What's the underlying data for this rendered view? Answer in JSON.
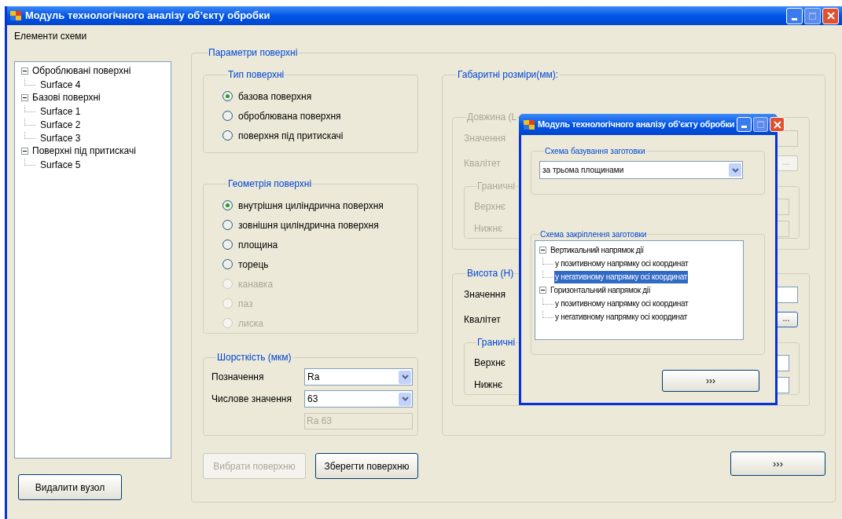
{
  "window": {
    "title": "Модуль технологічного аналізу об’єкту обробки"
  },
  "elements_panel": {
    "label": "Елементи схеми",
    "tree": [
      {
        "label": "Оброблювані поверхні",
        "expanded": true,
        "children": [
          {
            "label": "Surface 4"
          }
        ]
      },
      {
        "label": "Базові поверхні",
        "expanded": true,
        "children": [
          {
            "label": "Surface 1"
          },
          {
            "label": "Surface 2"
          },
          {
            "label": "Surface 3"
          }
        ]
      },
      {
        "label": "Поверхні під притискачі",
        "expanded": true,
        "children": [
          {
            "label": "Surface 5"
          }
        ]
      }
    ],
    "delete_button": "Видалити вузол"
  },
  "surface_params": {
    "title": "Параметри поверхні",
    "surface_type": {
      "title": "Тип поверхні",
      "options": [
        {
          "label": "базова поверхня",
          "selected": true,
          "disabled": false
        },
        {
          "label": "оброблювана поверхня",
          "selected": false,
          "disabled": false
        },
        {
          "label": "поверхня під притискачі",
          "selected": false,
          "disabled": false
        }
      ]
    },
    "geometry": {
      "title": "Геометрія поверхні",
      "options": [
        {
          "label": "внутрішня циліндрична поверхня",
          "selected": true,
          "disabled": false
        },
        {
          "label": "зовнішня циліндрична поверхня",
          "selected": false,
          "disabled": false
        },
        {
          "label": "площина",
          "selected": false,
          "disabled": false
        },
        {
          "label": "торець",
          "selected": false,
          "disabled": false
        },
        {
          "label": "канавка",
          "selected": false,
          "disabled": true
        },
        {
          "label": "паз",
          "selected": false,
          "disabled": true
        },
        {
          "label": "лиска",
          "selected": false,
          "disabled": true
        }
      ]
    },
    "roughness": {
      "title": "Шорсткість (мкм)",
      "designation_label": "Позначення",
      "designation_value": "Ra",
      "numeric_label": "Числове значення",
      "numeric_value": "63",
      "result": {
        "value": "Ra 63",
        "disabled": true
      }
    },
    "select_button": {
      "label": "Вибрати поверхню",
      "disabled": true
    },
    "save_button": {
      "label": "Зберегти поверхню",
      "disabled": false
    },
    "dimensions": {
      "title": "Габаритні розміри(мм):",
      "groups": [
        {
          "title": "Довжина (L",
          "disabled": true,
          "value_label": "Значення",
          "grade_label": "Квалітет",
          "grade_button": "...",
          "limits": {
            "title": "Граничні",
            "upper_label": "Верхнє",
            "lower_label": "Нижнє"
          }
        },
        {
          "title": "Висота (H)",
          "disabled": false,
          "value_label": "Значення",
          "grade_label": "Квалітет",
          "grade_button": "...",
          "limits": {
            "title": "Граничні",
            "upper_label": "Верхнє",
            "lower_label": "Нижнє"
          }
        }
      ]
    }
  },
  "next_button": "›››",
  "dialog": {
    "title": "Модуль технологічного аналізу об’єкту обробки",
    "basing": {
      "title": "Схема базування заготовки",
      "value": "за трьома площинами"
    },
    "clamping": {
      "title": "Схема закріплення заготовки",
      "tree": [
        {
          "label": "Вертикальний напрямок дії",
          "expanded": true,
          "selected": false,
          "children": [
            {
              "label": "у позитивному напрямку осі координат",
              "selected": false
            },
            {
              "label": "у негативному напрямку осі координат",
              "selected": true
            }
          ]
        },
        {
          "label": "Горизонтальний напрямок дії",
          "expanded": true,
          "selected": false,
          "children": [
            {
              "label": "у позитивному напрямку осі координат",
              "selected": false
            },
            {
              "label": "у негативному напрямку осі координат",
              "selected": false
            }
          ]
        }
      ]
    },
    "next_button": "›››"
  }
}
